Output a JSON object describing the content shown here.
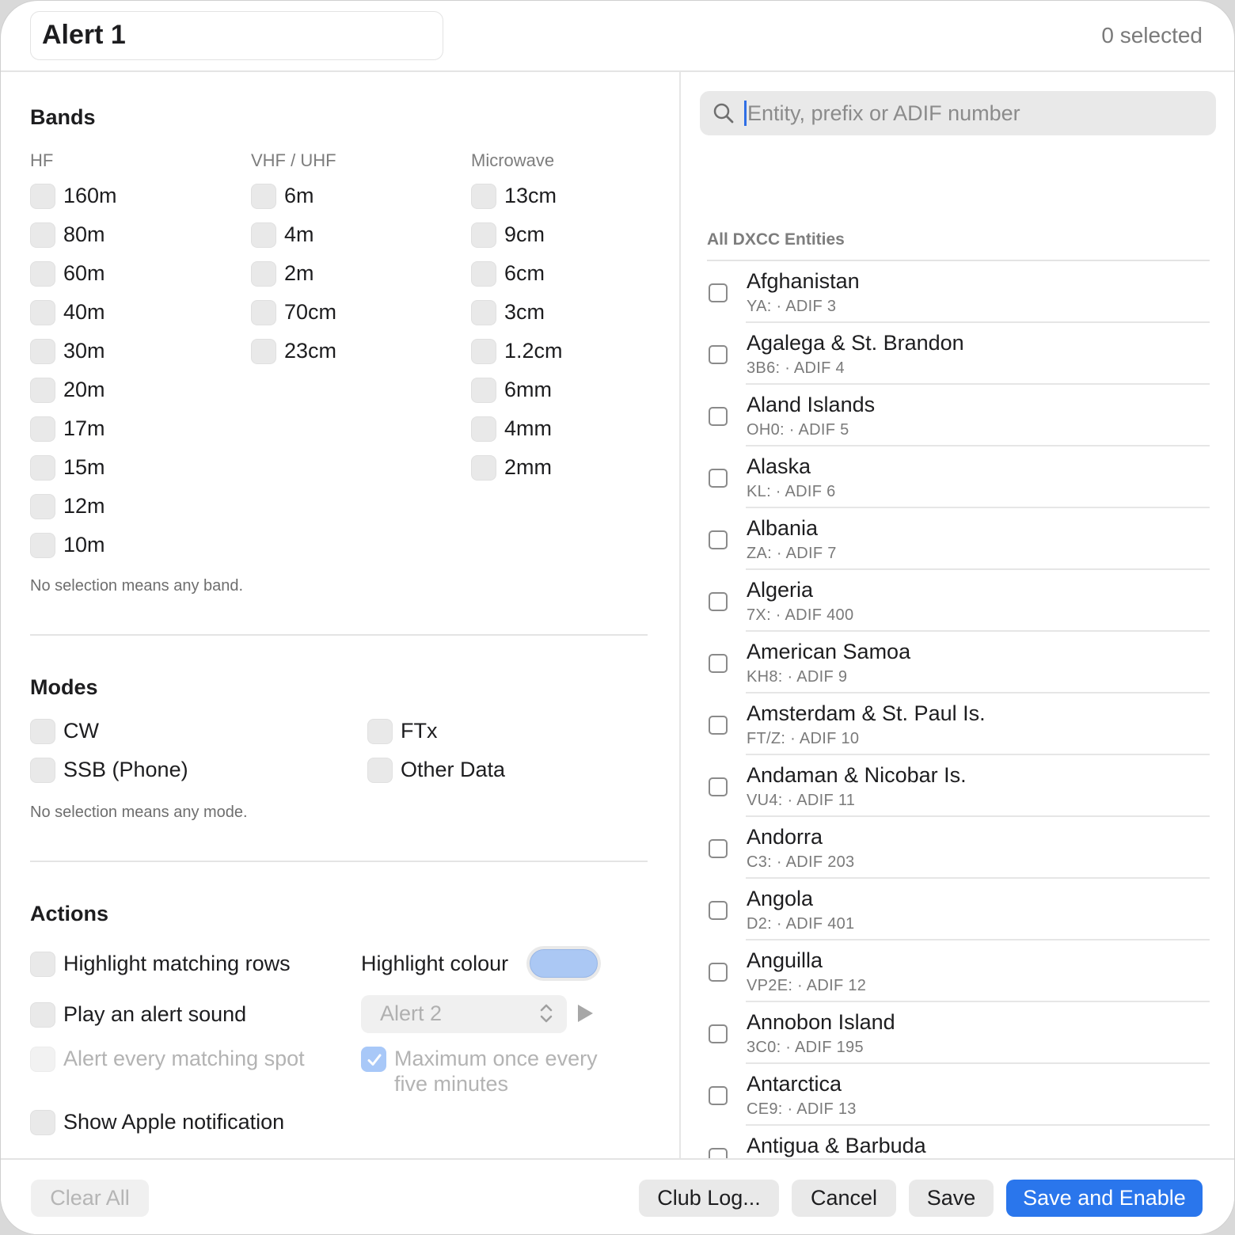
{
  "header": {
    "alert_name": "Alert 1",
    "selected_count": "0 selected"
  },
  "bands": {
    "title": "Bands",
    "columns": [
      {
        "heading": "HF",
        "items": [
          "160m",
          "80m",
          "60m",
          "40m",
          "30m",
          "20m",
          "17m",
          "15m",
          "12m",
          "10m"
        ]
      },
      {
        "heading": "VHF / UHF",
        "items": [
          "6m",
          "4m",
          "2m",
          "70cm",
          "23cm"
        ]
      },
      {
        "heading": "Microwave",
        "items": [
          "13cm",
          "9cm",
          "6cm",
          "3cm",
          "1.2cm",
          "6mm",
          "4mm",
          "2mm"
        ]
      }
    ],
    "hint": "No selection means any band."
  },
  "modes": {
    "title": "Modes",
    "items": [
      "CW",
      "SSB (Phone)",
      "FTx",
      "Other Data"
    ],
    "hint": "No selection means any mode."
  },
  "actions": {
    "title": "Actions",
    "highlight_rows": "Highlight matching rows",
    "highlight_colour_label": "Highlight colour",
    "highlight_colour": "#abc8f4",
    "play_sound": "Play an alert sound",
    "sound_value": "Alert 2",
    "alert_every": "Alert every matching spot",
    "max_once_line1": "Maximum once every",
    "max_once_line2": "five minutes",
    "max_once_checked": true,
    "apple_notification": "Show Apple notification"
  },
  "search": {
    "placeholder": "Entity, prefix or ADIF number",
    "value": ""
  },
  "entities": {
    "heading": "All DXCC Entities",
    "items": [
      {
        "name": "Afghanistan",
        "sub": "YA: · ADIF 3"
      },
      {
        "name": "Agalega & St. Brandon",
        "sub": "3B6: · ADIF 4"
      },
      {
        "name": "Aland Islands",
        "sub": "OH0: · ADIF 5"
      },
      {
        "name": "Alaska",
        "sub": "KL: · ADIF 6"
      },
      {
        "name": "Albania",
        "sub": "ZA: · ADIF 7"
      },
      {
        "name": "Algeria",
        "sub": "7X: · ADIF 400"
      },
      {
        "name": "American Samoa",
        "sub": "KH8: · ADIF 9"
      },
      {
        "name": "Amsterdam & St. Paul Is.",
        "sub": "FT/Z: · ADIF 10"
      },
      {
        "name": "Andaman & Nicobar Is.",
        "sub": "VU4: · ADIF 11"
      },
      {
        "name": "Andorra",
        "sub": "C3: · ADIF 203"
      },
      {
        "name": "Angola",
        "sub": "D2: · ADIF 401"
      },
      {
        "name": "Anguilla",
        "sub": "VP2E: · ADIF 12"
      },
      {
        "name": "Annobon Island",
        "sub": "3C0: · ADIF 195"
      },
      {
        "name": "Antarctica",
        "sub": "CE9: · ADIF 13"
      },
      {
        "name": "Antigua & Barbuda",
        "sub": ""
      }
    ]
  },
  "footer": {
    "clear_all": "Clear All",
    "club_log": "Club Log...",
    "cancel": "Cancel",
    "save": "Save",
    "save_enable": "Save and Enable"
  },
  "colors": {
    "accent": "#2a76ec"
  }
}
